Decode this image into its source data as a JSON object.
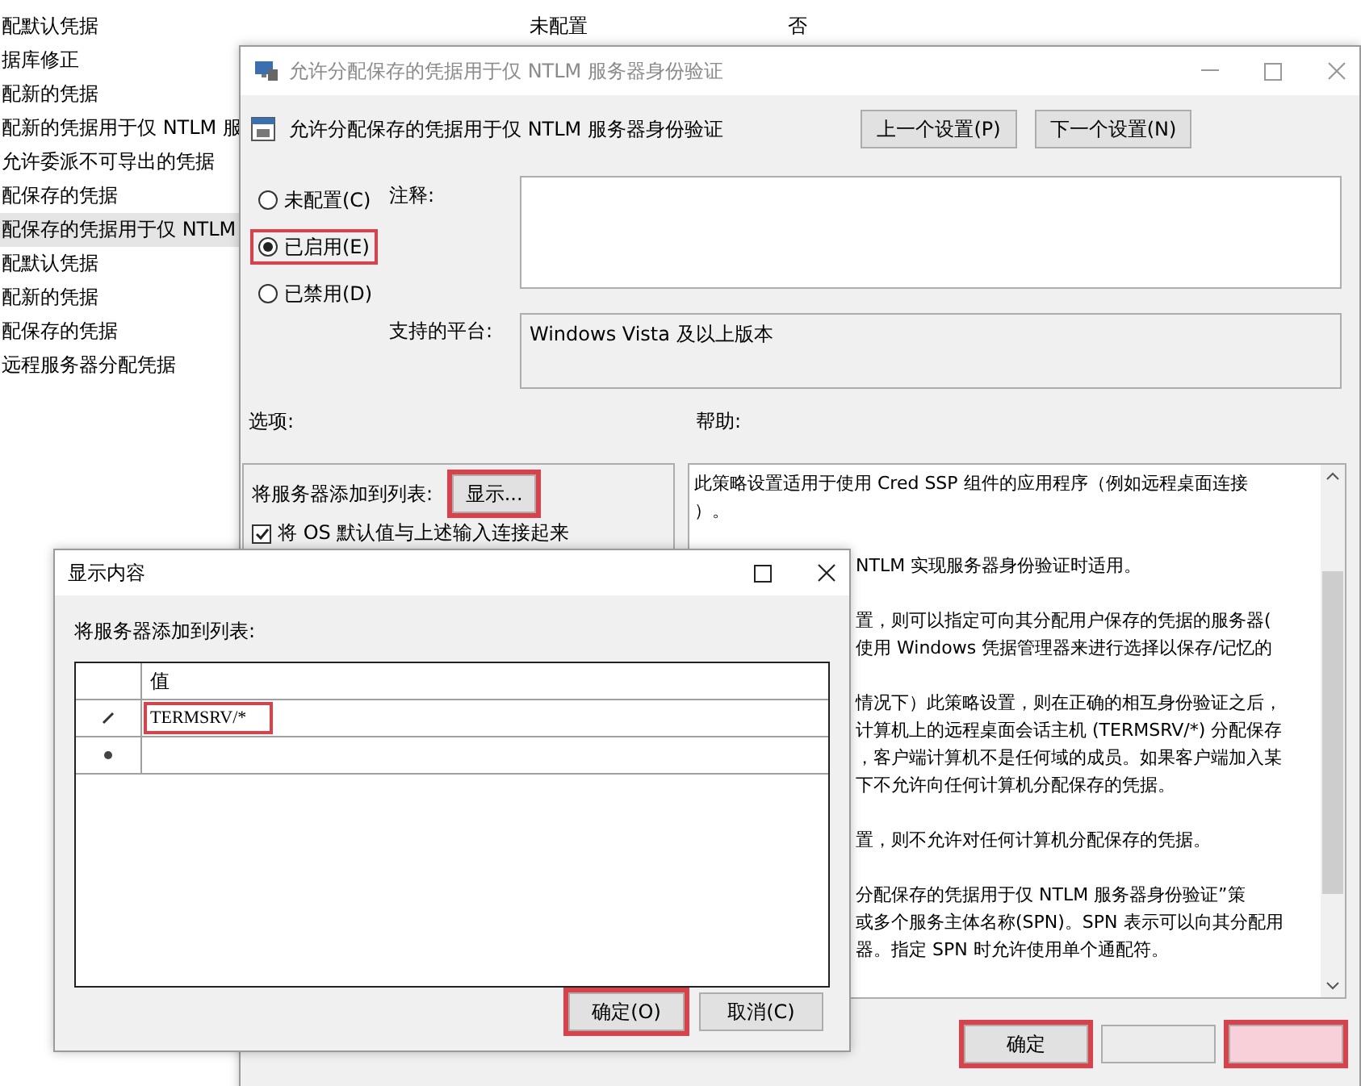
{
  "background_list": {
    "rows": [
      {
        "name": "配默认凭据",
        "state": "未配置",
        "column_3": "否",
        "selected": false
      },
      {
        "name": "据库修正",
        "selected": false
      },
      {
        "name": "配新的凭据",
        "selected": false
      },
      {
        "name": "配新的凭据用于仅 NTLM 服",
        "selected": false
      },
      {
        "name": "允许委派不可导出的凭据",
        "selected": false
      },
      {
        "name": "配保存的凭据",
        "selected": false
      },
      {
        "name": "配保存的凭据用于仅 NTLM",
        "selected": true
      },
      {
        "name": "配默认凭据",
        "selected": false
      },
      {
        "name": "配新的凭据",
        "selected": false
      },
      {
        "name": "配保存的凭据",
        "selected": false
      },
      {
        "name": "远程服务器分配凭据",
        "selected": false
      }
    ]
  },
  "policy_window": {
    "title": "允许分配保存的凭据用于仅 NTLM 服务器身份验证",
    "heading": "允许分配保存的凭据用于仅 NTLM 服务器身份验证",
    "nav_buttons": [
      "上一个设置(P)",
      "下一个设置(N)"
    ],
    "radios": [
      {
        "label": "未配置(C)",
        "selected": false,
        "highlighted": false
      },
      {
        "label": "已启用(E)",
        "selected": true,
        "highlighted": true
      },
      {
        "label": "已禁用(D)",
        "selected": false,
        "highlighted": false
      }
    ],
    "comment_label": "注释:",
    "platform_label": "支持的平台:",
    "platform_value": "Windows Vista 及以上版本",
    "options_label": "选项:",
    "help_label": "帮助:",
    "options": {
      "server_label": "将服务器添加到列表:",
      "show_button": {
        "label": "显示...",
        "highlighted": true
      },
      "checkbox": {
        "label": "将 OS 默认值与上述输入连接起来",
        "checked": true
      }
    },
    "help": {
      "paragraphs": [
        {
          "lines": [
            {
              "text": "此策略设置适用于使用 Cred SSP 组件的应用程序（例如远程桌面连接",
              "kind": "full"
            },
            {
              "text": "）。",
              "kind": "full"
            }
          ]
        },
        {
          "lines": [
            {
              "text": "NTLM 实现服务器身份验证时适用。",
              "kind": "partial"
            }
          ]
        },
        {
          "lines": [
            {
              "text": "置，则可以指定可向其分配用户保存的凭据的服务器(",
              "kind": "partial"
            },
            {
              "text": "使用 Windows 凭据管理器来进行选择以保存/记忆的",
              "kind": "partial"
            }
          ]
        },
        {
          "lines": [
            {
              "text": "情况下）此策略设置，则在正确的相互身份验证之后，",
              "kind": "partial"
            },
            {
              "text": "计算机上的远程桌面会话主机 (TERMSRV/*) 分配保存",
              "kind": "partial"
            },
            {
              "text": "，客户端计算机不是任何域的成员。如果客户端加入某",
              "kind": "partial"
            },
            {
              "text": "下不允许向任何计算机分配保存的凭据。",
              "kind": "partial"
            }
          ]
        },
        {
          "lines": [
            {
              "text": "置，则不允许对任何计算机分配保存的凭据。",
              "kind": "partial"
            }
          ]
        },
        {
          "lines": [
            {
              "text": "分配保存的凭据用于仅 NTLM 服务器身份验证”策",
              "kind": "partial"
            },
            {
              "text": "或多个服务主体名称(SPN)。SPN 表示可以向其分配用",
              "kind": "partial"
            },
            {
              "text": "器。指定 SPN 时允许使用单个通配符。",
              "kind": "partial"
            }
          ]
        }
      ]
    },
    "footer_buttons": [
      {
        "label": "确定",
        "highlighted": true,
        "kind": "normal"
      },
      {
        "highlighted": false,
        "kind": "blank"
      },
      {
        "highlighted": true,
        "kind": "pink"
      }
    ]
  },
  "show_contents_window": {
    "title": "显示内容",
    "list_label": "将服务器添加到列表:",
    "column": "值",
    "rows": [
      {
        "kind": "edit",
        "value": "TERMSRV/*",
        "highlighted": true
      },
      {
        "kind": "new"
      }
    ],
    "buttons": [
      {
        "label": "确定(O)",
        "highlighted": true
      },
      {
        "label": "取消(C)",
        "highlighted": false
      }
    ]
  }
}
